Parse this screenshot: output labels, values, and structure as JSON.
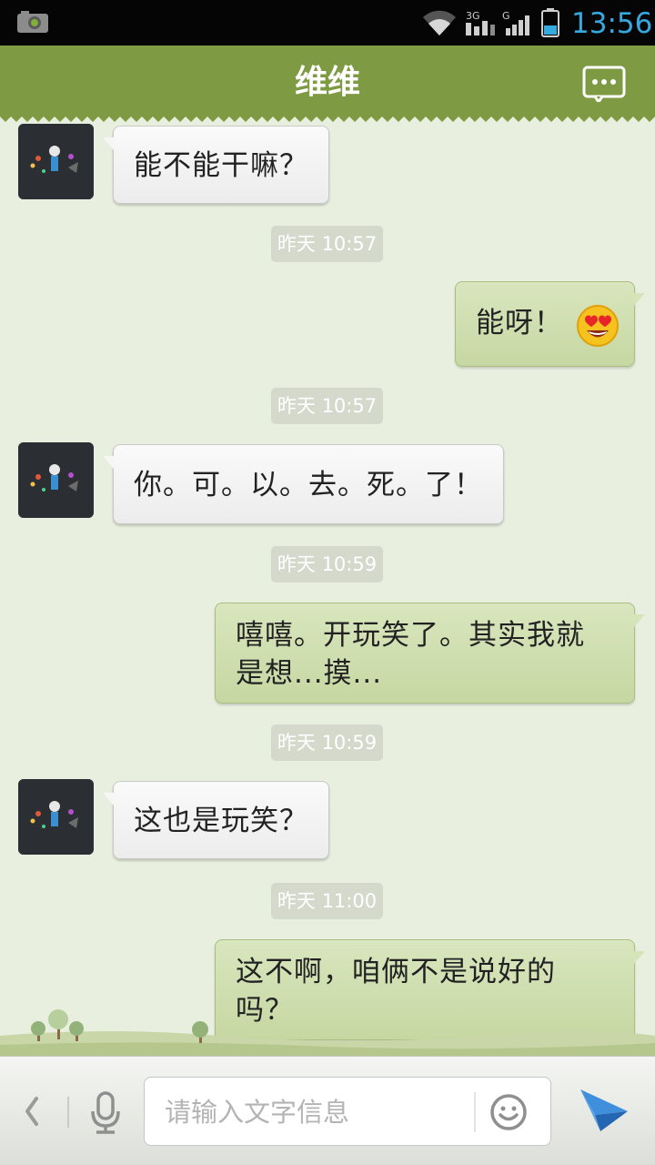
{
  "status_bar": {
    "time": "13:56",
    "network_label_a": "3G",
    "network_label_b": "G"
  },
  "header": {
    "title": "维维"
  },
  "messages": [
    {
      "type": "received",
      "text": "能不能干嘛？"
    },
    {
      "type": "timestamp",
      "text": "昨天 10:57"
    },
    {
      "type": "sent",
      "text": "能呀！",
      "emoji": "heart-eyes"
    },
    {
      "type": "timestamp",
      "text": "昨天 10:57"
    },
    {
      "type": "received",
      "text": "你。可。以。去。死。了！"
    },
    {
      "type": "timestamp",
      "text": "昨天 10:59"
    },
    {
      "type": "sent",
      "lines": [
        "嘻嘻。开玩笑了。其实我就",
        "是想...摸..."
      ]
    },
    {
      "type": "timestamp",
      "text": "昨天 10:59"
    },
    {
      "type": "received",
      "text": "这也是玩笑？"
    },
    {
      "type": "timestamp",
      "text": "昨天 11:00"
    },
    {
      "type": "sent",
      "lines": [
        "这不啊，咱俩不是说好的",
        "吗？"
      ]
    }
  ],
  "input_bar": {
    "placeholder": "请输入文字信息",
    "icons": [
      "back-icon",
      "microphone-icon",
      "smiley-icon",
      "send-icon"
    ]
  },
  "colors": {
    "header": "#7e9a43",
    "background": "#e9efde",
    "sent_bubble": "#d0dfb1",
    "received_bubble": "#f4f4f4",
    "clock": "#36a9df",
    "send_icon": "#2e7fd0"
  }
}
